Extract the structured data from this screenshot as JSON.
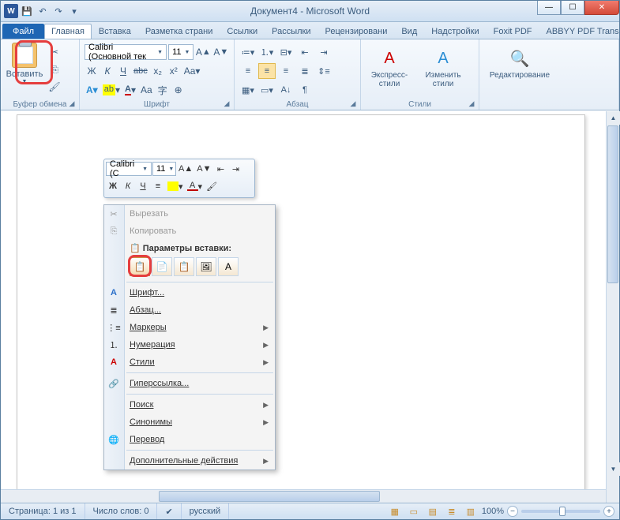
{
  "titlebar": {
    "doc_title": "Документ4 - Microsoft Word"
  },
  "tabs": {
    "file": "Файл",
    "items": [
      "Главная",
      "Вставка",
      "Разметка страни",
      "Ссылки",
      "Рассылки",
      "Рецензировани",
      "Вид",
      "Надстройки",
      "Foxit PDF",
      "ABBYY PDF Trans"
    ],
    "active_index": 0
  },
  "ribbon": {
    "clipboard": {
      "paste_label": "Вставить",
      "group": "Буфер обмена"
    },
    "font": {
      "group": "Шрифт",
      "name": "Calibri (Основной тек",
      "size": "11",
      "bold": "Ж",
      "italic": "К",
      "under": "Ч"
    },
    "paragraph": {
      "group": "Абзац"
    },
    "styles": {
      "group": "Стили",
      "quick": "Экспресс-стили",
      "change": "Изменить стили"
    },
    "editing": {
      "group": "Редактирование"
    }
  },
  "minitoolbar": {
    "font": "Calibri (С",
    "size": "11",
    "bold": "Ж",
    "italic": "К",
    "under": "Ч"
  },
  "ctxmenu": {
    "cut": "Вырезать",
    "copy": "Копировать",
    "paste_options": "Параметры вставки:",
    "font": "Шрифт...",
    "paragraph": "Абзац...",
    "bullets": "Маркеры",
    "numbering": "Нумерация",
    "styles": "Стили",
    "hyperlink": "Гиперссылка...",
    "search": "Поиск",
    "synonyms": "Синонимы",
    "translate": "Перевод",
    "additional": "Дополнительные действия"
  },
  "statusbar": {
    "page": "Страница: 1 из 1",
    "words": "Число слов: 0",
    "lang": "русский",
    "zoom": "100%"
  }
}
